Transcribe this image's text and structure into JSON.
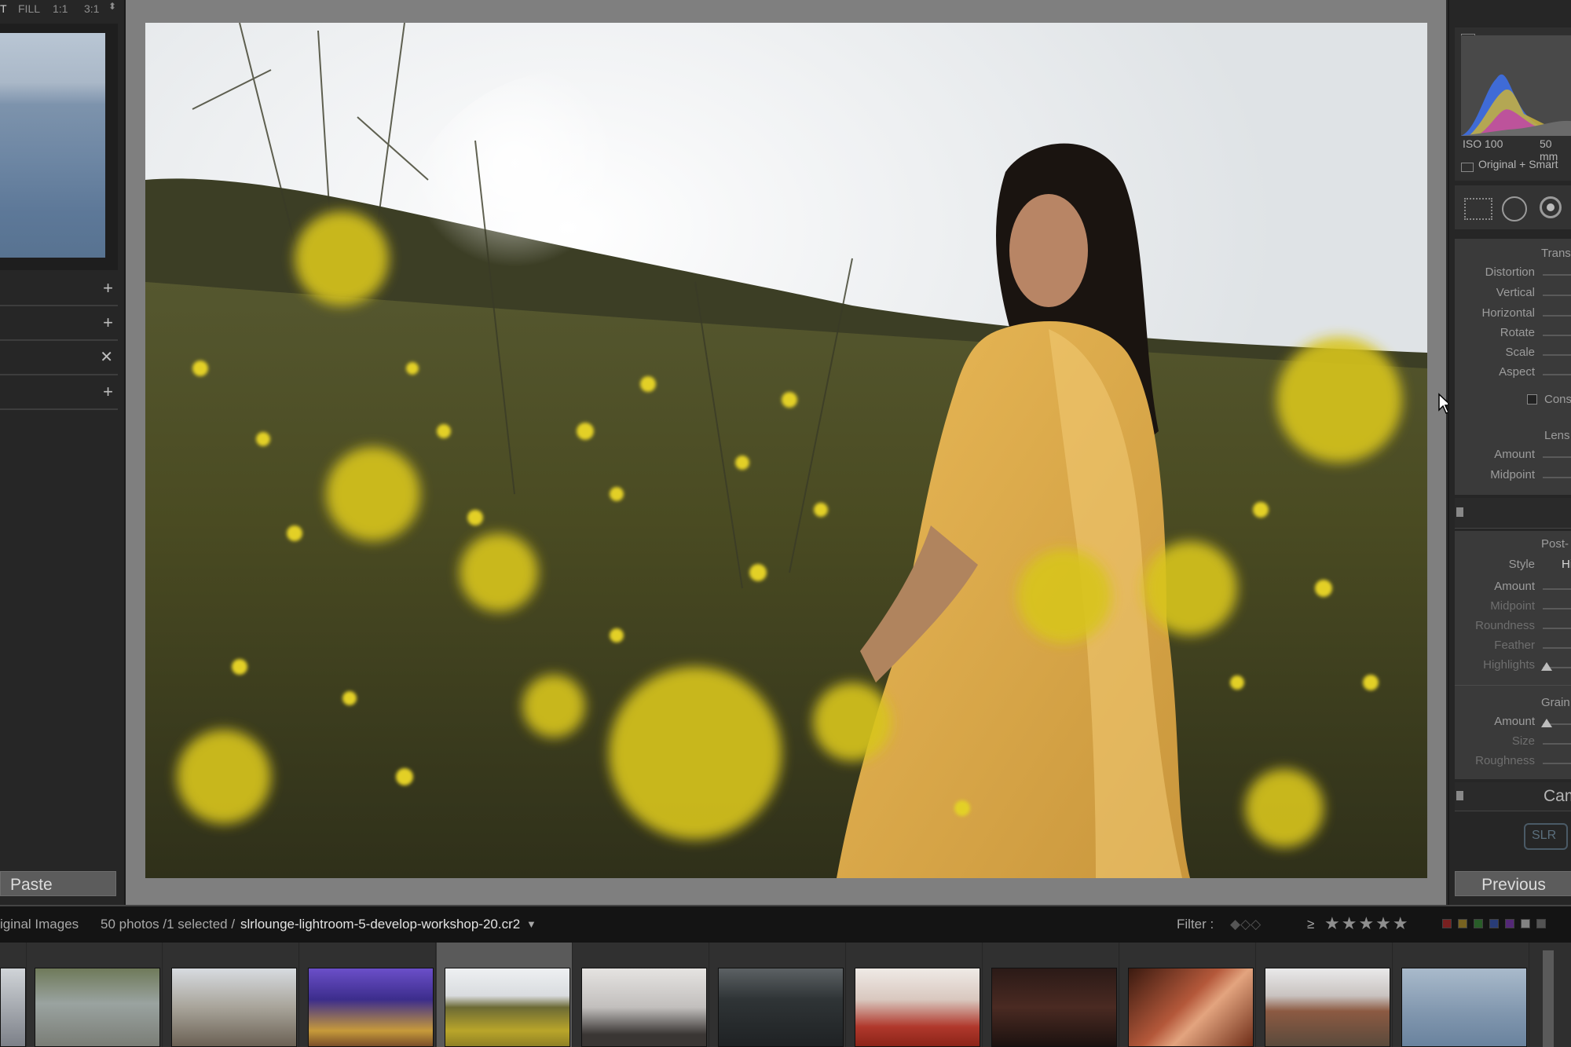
{
  "navigator": {
    "zoom_options": [
      "T",
      "FILL",
      "1:1",
      "3:1"
    ]
  },
  "left_panel": {
    "paste_label": "Paste"
  },
  "histogram": {
    "iso": "ISO 100",
    "focal_length": "50 mm",
    "preview_mode": "Original + Smart"
  },
  "transform": {
    "section_label": "Trans",
    "sliders": [
      "Distortion",
      "Vertical",
      "Horizontal",
      "Rotate",
      "Scale",
      "Aspect"
    ],
    "constrain_label": "Cons"
  },
  "lens_vignetting": {
    "section_label": "Lens",
    "sliders": [
      "Amount",
      "Midpoint"
    ]
  },
  "post_crop": {
    "section_label": "Post-",
    "style_label": "Style",
    "style_value": "Hi",
    "sliders": [
      "Amount",
      "Midpoint",
      "Roundness",
      "Feather",
      "Highlights"
    ]
  },
  "grain": {
    "section_label": "Grain",
    "sliders": [
      "Amount",
      "Size",
      "Roughness"
    ]
  },
  "camera_calibration": {
    "section_label": "Cam"
  },
  "right_panel": {
    "previous_label": "Previous",
    "slr_badge": "SLR"
  },
  "filmstrip_bar": {
    "source_label": "iginal Images",
    "count_text": "50 photos /1 selected /",
    "filename": "slrlounge-lightroom-5-develop-workshop-20.cr2",
    "filter_label": "Filter :",
    "rating_symbol": "≥",
    "stars": 5,
    "color_labels": [
      "#cc2b2b",
      "#c9a32b",
      "#3a9a3a",
      "#3a5ec9",
      "#8a3ac9",
      "#dddddd",
      "#888888"
    ]
  },
  "thumbnails": [
    {
      "name": "city-street",
      "selected": false
    },
    {
      "name": "couple-bicycles",
      "selected": false
    },
    {
      "name": "wooden-posts",
      "selected": false
    },
    {
      "name": "ballroom",
      "selected": false
    },
    {
      "name": "flower-field-portrait",
      "selected": true
    },
    {
      "name": "bride-mirror",
      "selected": false
    },
    {
      "name": "groomsmen",
      "selected": false
    },
    {
      "name": "indian-bride",
      "selected": false
    },
    {
      "name": "night-couple",
      "selected": false
    },
    {
      "name": "antelope-canyon",
      "selected": false
    },
    {
      "name": "horseshoe-bend",
      "selected": false
    },
    {
      "name": "lake-birds",
      "selected": false
    }
  ]
}
